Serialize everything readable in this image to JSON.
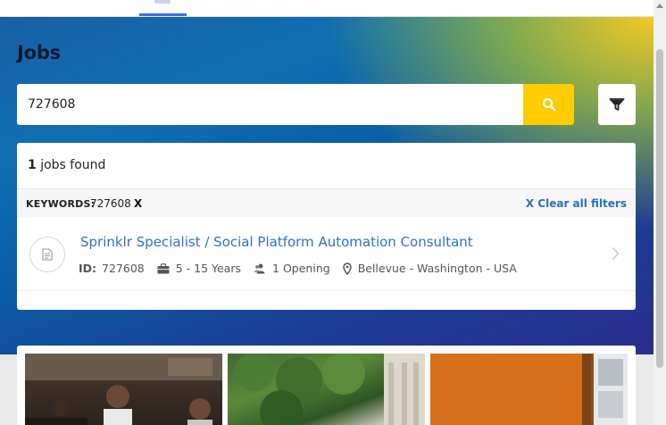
{
  "header": {
    "page_title": "Jobs"
  },
  "search": {
    "value": "727608",
    "placeholder": ""
  },
  "results": {
    "count": "1",
    "count_suffix": " jobs found",
    "filters": {
      "keywords_label": "KEYWORDS:",
      "keywords_value": "727608",
      "remove_label": "X",
      "clear_all_label": "X Clear all filters"
    },
    "jobs": [
      {
        "title": "Sprinklr Specialist / Social Platform Automation Consultant",
        "id_label": "ID:",
        "id": "727608",
        "experience": "5 - 15 Years",
        "openings": "1 Opening",
        "location": "Bellevue - Washington - USA"
      }
    ]
  },
  "colors": {
    "accent_yellow": "#ffcc00",
    "link_blue": "#2f6fd0",
    "clear_blue": "#2f6fb5"
  },
  "icons": {
    "search": "search-icon",
    "filter": "filter-icon",
    "document": "document-icon",
    "briefcase": "briefcase-icon",
    "people": "people-icon",
    "location": "location-pin-icon",
    "chevron": "chevron-right-icon"
  }
}
